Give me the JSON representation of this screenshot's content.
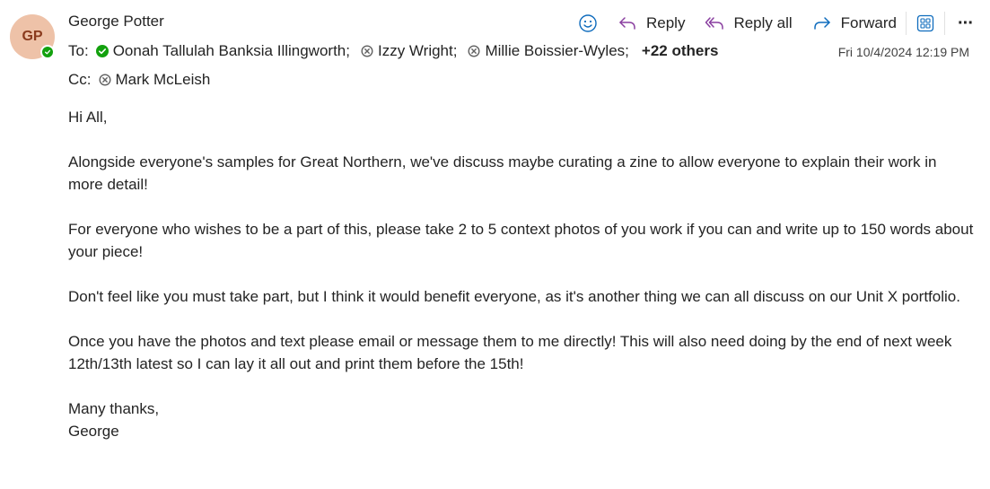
{
  "sender": {
    "initials": "GP",
    "name": "George Potter"
  },
  "toolbar": {
    "emoji_icon": "emoji-icon",
    "reply_label": "Reply",
    "reply_all_label": "Reply all",
    "forward_label": "Forward",
    "apps_icon": "apps-icon",
    "more_label": "···"
  },
  "to": {
    "label": "To:",
    "recipients": [
      {
        "name": "Oonah Tallulah Banksia Illingworth;",
        "status": "available"
      },
      {
        "name": "Izzy Wright;",
        "status": "blocked"
      },
      {
        "name": "Millie Boissier-Wyles;",
        "status": "blocked"
      }
    ],
    "others": "+22 others"
  },
  "cc": {
    "label": "Cc:",
    "recipients": [
      {
        "name": "Mark McLeish",
        "status": "blocked"
      }
    ]
  },
  "date": "Fri 10/4/2024 12:19 PM",
  "body": {
    "greeting": "Hi All,",
    "p1": "Alongside everyone's samples for Great Northern, we've discuss maybe curating a zine to allow everyone to explain their work in more detail!",
    "p2": "For everyone who wishes to be a part of this, please take 2 to 5 context photos of you work if you can and write up to 150 words about your piece!",
    "p3": "Don't feel like you must take part, but I think it would benefit everyone, as it's another thing we can all discuss on our Unit X portfolio.",
    "p4": "Once you have the photos and text please email or message them to me directly! This will also need doing by the end of next week 12th/13th latest so I can lay it all out and print them before the 15th!",
    "signoff": "Many thanks,",
    "signature": "George"
  },
  "colors": {
    "accent": "#0f6cbd",
    "reply_icon": "#8a3fa0",
    "presence": "#13a10e",
    "avatar_bg": "#eec2a8"
  }
}
